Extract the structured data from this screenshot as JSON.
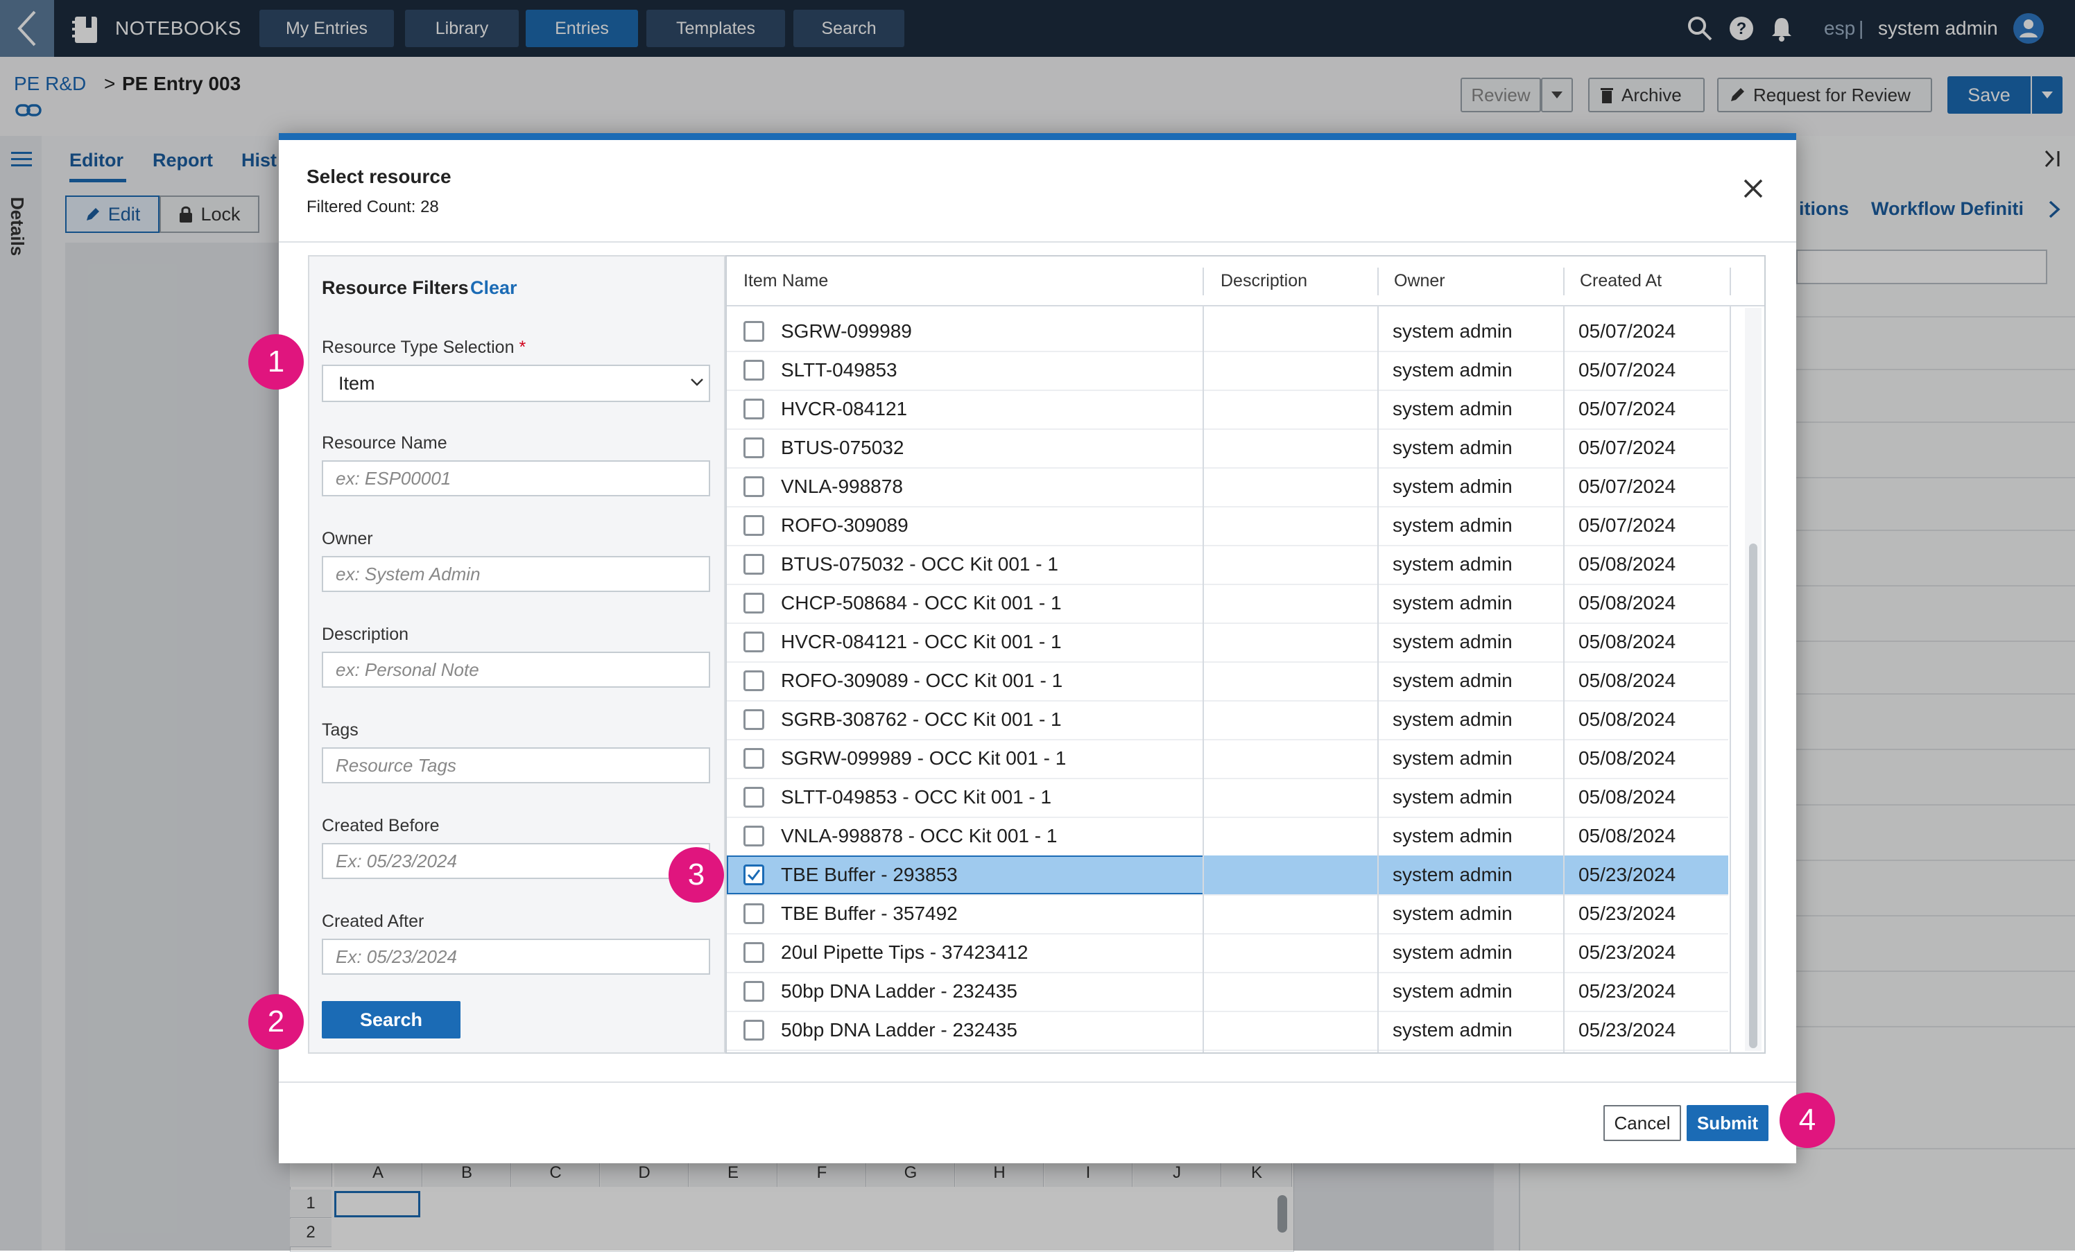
{
  "topnav": {
    "brand": "NOTEBOOKS",
    "tabs": [
      {
        "label": "My Entries",
        "active": false
      },
      {
        "label": "Library",
        "active": false
      },
      {
        "label": "Entries",
        "active": true
      },
      {
        "label": "Templates",
        "active": false
      },
      {
        "label": "Search",
        "active": false
      }
    ],
    "env": "esp",
    "separator": "|",
    "user": "system admin"
  },
  "breadcrumb": {
    "parent": "PE R&D",
    "separator": ">",
    "current": "PE Entry 003"
  },
  "header_actions": {
    "review": "Review",
    "archive": "Archive",
    "request_review": "Request for Review",
    "save": "Save"
  },
  "left_rail": {
    "details": "Details"
  },
  "editor": {
    "tabs": [
      "Editor",
      "Report",
      "Hist"
    ],
    "edit": "Edit",
    "lock": "Lock",
    "sheet_columns": [
      "A",
      "B",
      "C",
      "D",
      "E",
      "F",
      "G",
      "H",
      "I",
      "J",
      "K"
    ],
    "sheet_rows": [
      "1",
      "2"
    ]
  },
  "right_panel": {
    "tabs": [
      "itions",
      "Workflow Definiti"
    ]
  },
  "modal": {
    "title": "Select resource",
    "filtered_count": "Filtered Count: 28",
    "filters": {
      "title": "Resource Filters",
      "clear": "Clear",
      "resource_type_label": "Resource Type Selection",
      "required_mark": "*",
      "resource_type_value": "Item",
      "resource_name_label": "Resource Name",
      "resource_name_placeholder": "ex: ESP00001",
      "owner_label": "Owner",
      "owner_placeholder": "ex: System Admin",
      "description_label": "Description",
      "description_placeholder": "ex: Personal Note",
      "tags_label": "Tags",
      "tags_placeholder": "Resource Tags",
      "created_before_label": "Created Before",
      "created_before_placeholder": "Ex: 05/23/2024",
      "created_after_label": "Created After",
      "created_after_placeholder": "Ex: 05/23/2024",
      "search": "Search"
    },
    "table": {
      "columns": [
        "Item Name",
        "Description",
        "Owner",
        "Created At"
      ],
      "rows": [
        {
          "name": "SGRW-099989",
          "description": "",
          "owner": "system admin",
          "created": "05/07/2024",
          "checked": false
        },
        {
          "name": "SLTT-049853",
          "description": "",
          "owner": "system admin",
          "created": "05/07/2024",
          "checked": false
        },
        {
          "name": "HVCR-084121",
          "description": "",
          "owner": "system admin",
          "created": "05/07/2024",
          "checked": false
        },
        {
          "name": "BTUS-075032",
          "description": "",
          "owner": "system admin",
          "created": "05/07/2024",
          "checked": false
        },
        {
          "name": "VNLA-998878",
          "description": "",
          "owner": "system admin",
          "created": "05/07/2024",
          "checked": false
        },
        {
          "name": "ROFO-309089",
          "description": "",
          "owner": "system admin",
          "created": "05/07/2024",
          "checked": false
        },
        {
          "name": "BTUS-075032 - OCC Kit 001 - 1",
          "description": "",
          "owner": "system admin",
          "created": "05/08/2024",
          "checked": false
        },
        {
          "name": "CHCP-508684 - OCC Kit 001 - 1",
          "description": "",
          "owner": "system admin",
          "created": "05/08/2024",
          "checked": false
        },
        {
          "name": "HVCR-084121 - OCC Kit 001 - 1",
          "description": "",
          "owner": "system admin",
          "created": "05/08/2024",
          "checked": false
        },
        {
          "name": "ROFO-309089 - OCC Kit 001 - 1",
          "description": "",
          "owner": "system admin",
          "created": "05/08/2024",
          "checked": false
        },
        {
          "name": "SGRB-308762 - OCC Kit 001 - 1",
          "description": "",
          "owner": "system admin",
          "created": "05/08/2024",
          "checked": false
        },
        {
          "name": "SGRW-099989 - OCC Kit 001 - 1",
          "description": "",
          "owner": "system admin",
          "created": "05/08/2024",
          "checked": false
        },
        {
          "name": "SLTT-049853 - OCC Kit 001 - 1",
          "description": "",
          "owner": "system admin",
          "created": "05/08/2024",
          "checked": false
        },
        {
          "name": "VNLA-998878 - OCC Kit 001 - 1",
          "description": "",
          "owner": "system admin",
          "created": "05/08/2024",
          "checked": false
        },
        {
          "name": "TBE Buffer - 293853",
          "description": "",
          "owner": "system admin",
          "created": "05/23/2024",
          "checked": true
        },
        {
          "name": "TBE Buffer - 357492",
          "description": "",
          "owner": "system admin",
          "created": "05/23/2024",
          "checked": false
        },
        {
          "name": "20ul Pipette Tips - 37423412",
          "description": "",
          "owner": "system admin",
          "created": "05/23/2024",
          "checked": false
        },
        {
          "name": "50bp DNA Ladder - 232435",
          "description": "",
          "owner": "system admin",
          "created": "05/23/2024",
          "checked": false
        },
        {
          "name": "50bp DNA Ladder - 232435",
          "description": "",
          "owner": "system admin",
          "created": "05/23/2024",
          "checked": false
        }
      ]
    },
    "footer": {
      "cancel": "Cancel",
      "submit": "Submit"
    }
  },
  "callouts": [
    "1",
    "2",
    "3",
    "4"
  ],
  "colors": {
    "brand": "#1b6bb5",
    "nav": "#1c2d3f",
    "selected_row": "#9fcaee",
    "callout": "#e0157e"
  }
}
